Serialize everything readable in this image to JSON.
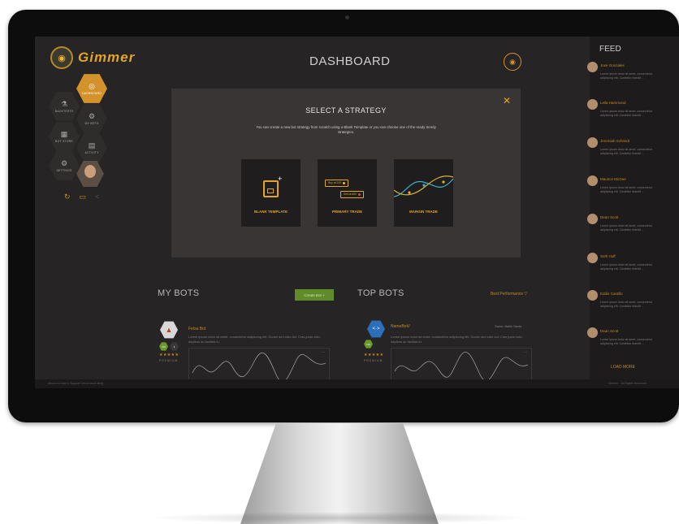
{
  "app": {
    "logo_text": "Gimmer",
    "title": "DASHBOARD"
  },
  "sidebar": {
    "items": [
      {
        "label": "DASHBOARD",
        "icon": "dashboard-icon"
      },
      {
        "label": "BACKTESTS",
        "icon": "flask-icon"
      },
      {
        "label": "MY BOTS",
        "icon": "bot-icon"
      },
      {
        "label": "BOT STORE",
        "icon": "store-icon"
      },
      {
        "label": "ACTIVITY",
        "icon": "activity-icon"
      },
      {
        "label": "SETTINGS",
        "icon": "settings-icon"
      }
    ]
  },
  "modal": {
    "close": "✕",
    "title": "SELECT A STRATEGY",
    "description": "You can create a new bot strategy from scratch using a Blank Template or you can choose one of the ready trendy strategies.",
    "cards": [
      {
        "label": "BLANK TEMPLATE"
      },
      {
        "label": "PRIMARY TRADE",
        "buy": "Buy at 200",
        "sell": "Sell at 600"
      },
      {
        "label": "MARGIN TRADE"
      }
    ]
  },
  "my_bots": {
    "title": "MY BOTS",
    "create_label": "Create Bot",
    "bot": {
      "name": "Felsa Bot",
      "desc": "Lorem ipsum dolor sit amet, consectetur adipiscing elit. Donec sed odio dui. Cras justo odio, dapibus ac facilisis in.",
      "stars": "★★★★★",
      "badge": "PREMIUM"
    }
  },
  "top_bots": {
    "title": "TOP BOTS",
    "filter": "Best Performance",
    "bot": {
      "name": "NameBot//",
      "owner": "Owner: Martin Garcia",
      "desc": "Lorem ipsum dolor sit amet, consectetur adipiscing elit. Donec sed odio dui. Cras justo odio, dapibus ac facilisis in.",
      "stars": "★★★★★",
      "badge": "PREMIUM"
    }
  },
  "feed": {
    "title": "FEED",
    "snippet": "Lorem ipsum dolor sit amet, consectetur adipiscing elit. Curabitur blandit ...",
    "items": [
      {
        "name": "Jose Gonzales"
      },
      {
        "name": "Leila Hammond"
      },
      {
        "name": "Jeremiah Schmidt"
      },
      {
        "name": "Maurice McGee"
      },
      {
        "name": "Dean Scott"
      },
      {
        "name": "Seth Huff"
      },
      {
        "name": "Eddie Castillo"
      },
      {
        "name": "Dean Scott"
      }
    ],
    "load_more": "LOAD MORE"
  },
  "footer": {
    "links": "About us   Help & Support   Get in touch   Blog",
    "copyright": "Gimmer · All Rights Reserved"
  },
  "colors": {
    "accent": "#e2a524",
    "green": "#6a9a2b",
    "screen_bg": "#262424"
  }
}
